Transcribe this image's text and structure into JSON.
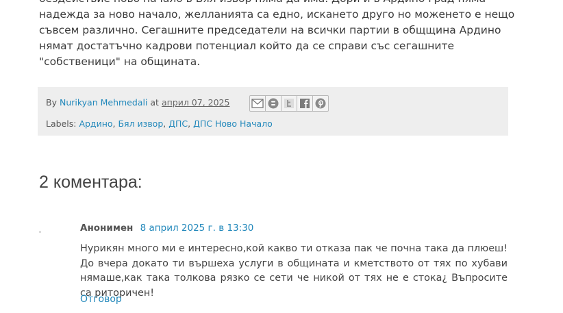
{
  "post": {
    "paragraph": "бездействие ново начало в Бял извор няма да има. Дори и в Ардино град няма надежда за ново начало, желланията са едно, искането друго но моженето е нещо съвсем различно. Сегашните председатели на всички партии в общщина Ардино нямат достатъчно кадрови потенциал който да се справи със сегашните \"собственици\" на общината."
  },
  "footer": {
    "by_label": "By",
    "author": "Nurikyan Mehmedali",
    "at_label": "at",
    "timestamp": "април 07, 2025",
    "labels_prefix": "Labels:",
    "labels": [
      "Ардино",
      "Бял извор",
      "ДПС",
      "ДПС Ново Начало"
    ],
    "separator": ",",
    "share_buttons": [
      "email-icon",
      "blogger-icon",
      "twitter-icon",
      "facebook-icon",
      "pinterest-icon"
    ]
  },
  "comments": {
    "title": "2 коментара:",
    "items": [
      {
        "author": "Анонимен",
        "date": "8 април 2025 г. в 13:30",
        "text": "Нурикян много ми е интересно,кой какво ти отказа пак че почна така да плюеш! До вчера докато ти вършеха услуги в общината и кметството от тях по хубави нямаше,как така толкова рязко се сети че никой от тях не е стока¿ Въпросите са риторичен!",
        "reply_label": "Отговор"
      }
    ]
  },
  "colors": {
    "link": "#2288bb",
    "footer_bg": "#eeeeee",
    "text": "#3a3a3a"
  }
}
